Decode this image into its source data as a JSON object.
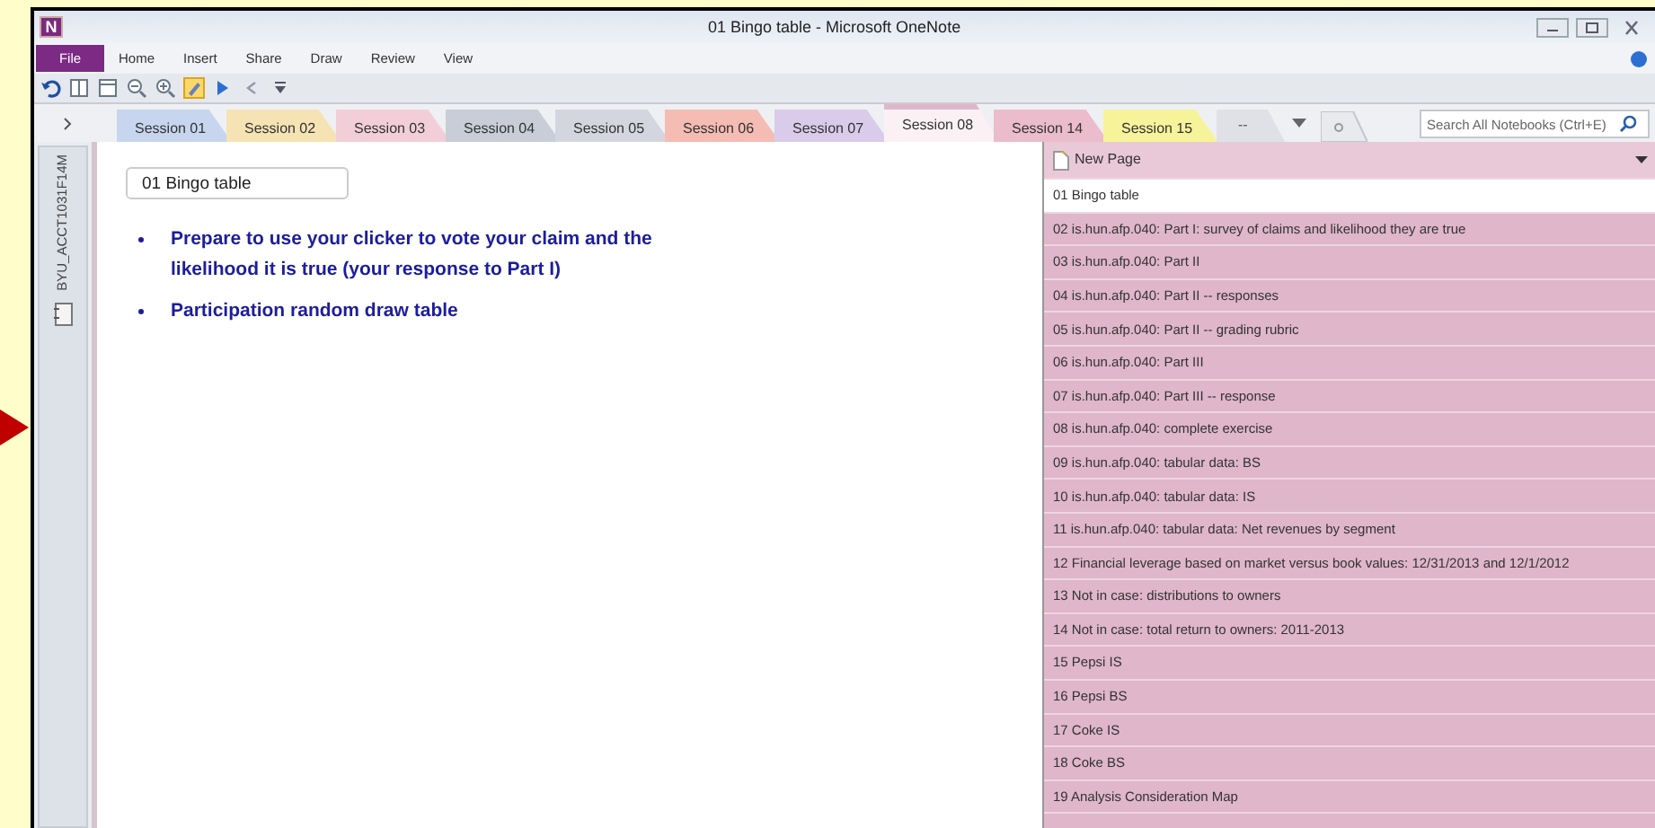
{
  "window": {
    "app_logo": "N",
    "title": "01 Bingo table - Microsoft OneNote"
  },
  "ribbon": {
    "file_tab": "File",
    "tabs": [
      "Home",
      "Insert",
      "Share",
      "Draw",
      "Review",
      "View"
    ]
  },
  "section_tabs": [
    {
      "label": "Session 01",
      "color": "#c7d5ef",
      "selected": false
    },
    {
      "label": "Session 02",
      "color": "#f5e3b3",
      "selected": false
    },
    {
      "label": "Session 03",
      "color": "#f2cfd8",
      "selected": false
    },
    {
      "label": "Session 04",
      "color": "#c9cdd7",
      "selected": false
    },
    {
      "label": "Session 05",
      "color": "#d3d6de",
      "selected": false
    },
    {
      "label": "Session 06",
      "color": "#f5bcb3",
      "selected": false
    },
    {
      "label": "Session 07",
      "color": "#d9cbe9",
      "selected": false
    },
    {
      "label": "Session 08",
      "color": "#dfb6ca",
      "selected": true
    },
    {
      "label": "Session 14",
      "color": "#ebbccb",
      "selected": false
    },
    {
      "label": "Session 15",
      "color": "#f7f39b",
      "selected": false
    }
  ],
  "overflow_tab": "--",
  "search": {
    "placeholder": "Search All Notebooks (Ctrl+E)"
  },
  "notebook": {
    "name": "BYU_ACCT1031F14M"
  },
  "page": {
    "title": "01 Bingo table",
    "bullets": [
      "Prepare to use your clicker to vote your claim and the likelihood it is true (your response to Part I)",
      "Participation random draw table"
    ]
  },
  "pages_panel": {
    "new_page": "New Page",
    "pages": [
      {
        "title": "01 Bingo table",
        "selected": true
      },
      {
        "title": "02 is.hun.afp.040: Part I: survey of claims and likelihood they are true",
        "selected": false
      },
      {
        "title": "03 is.hun.afp.040: Part II",
        "selected": false
      },
      {
        "title": "04 is.hun.afp.040: Part II -- responses",
        "selected": false
      },
      {
        "title": "05 is.hun.afp.040: Part II -- grading rubric",
        "selected": false
      },
      {
        "title": "06 is.hun.afp.040: Part III",
        "selected": false
      },
      {
        "title": "07 is.hun.afp.040: Part III -- response",
        "selected": false
      },
      {
        "title": "08 is.hun.afp.040: complete exercise",
        "selected": false
      },
      {
        "title": "09 is.hun.afp.040: tabular data: BS",
        "selected": false
      },
      {
        "title": "10 is.hun.afp.040: tabular data: IS",
        "selected": false
      },
      {
        "title": "11 is.hun.afp.040: tabular data: Net revenues by segment",
        "selected": false
      },
      {
        "title": "12 Financial leverage based on market versus book values: 12/31/2013 and 12/1/2012",
        "selected": false
      },
      {
        "title": "13  Not in case: distributions to owners",
        "selected": false
      },
      {
        "title": "14 Not in case: total return to owners: 2011-2013",
        "selected": false
      },
      {
        "title": "15 Pepsi IS",
        "selected": false
      },
      {
        "title": "16 Pepsi BS",
        "selected": false
      },
      {
        "title": "17 Coke IS",
        "selected": false
      },
      {
        "title": "18 Coke BS",
        "selected": false
      },
      {
        "title": "19 Analysis Consideration Map",
        "selected": false
      }
    ]
  }
}
